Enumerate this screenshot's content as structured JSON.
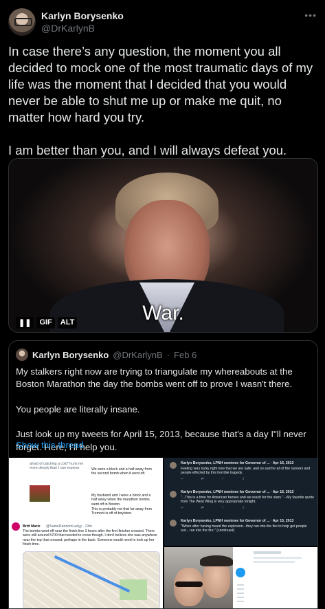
{
  "tweet": {
    "author_name": "Karlyn Borysenko",
    "author_handle": "@DrKarlynB",
    "more_icon": "more-icon",
    "text": "In case there’s any question, the moment you all decided to mock one of the most traumatic days of my life was the moment that I decided that you would never be able to shut me up or make me quit, no matter how hard you try.\n\nI am better than you, and I will always defeat you."
  },
  "gif": {
    "caption": "War.",
    "badges": {
      "pause": "❚❚",
      "gif": "GIF",
      "alt": "ALT"
    }
  },
  "quote": {
    "author_name": "Karlyn Borysenko",
    "author_handle": "@DrKarlynB",
    "separator": "·",
    "date": "Feb 6",
    "text": "My stalkers right now are trying to triangulate my whereabouts at the Boston Marathon the day the bombs went off to prove I wasn't there.\n\nYou people are literally insane.\n\nJust look up my tweets for April 15, 2013, because that's a day I\"ll never forget. Here, I'll help you.",
    "show_thread": "Show this thread"
  },
  "collage": {
    "shot_a": {
      "snippets": [
        "afraid of catching a cold\" hurts me more deeply than I can express",
        "We were a block and a half away from the second bomb when it went off.",
        "My husband and I were a block and a half away when the marathon bombs went off in Boston.",
        "This is probably not that far away from Tremont is off of boylston."
      ],
      "reply_author": "Britt Marie",
      "reply_handle": "@SameRandomLadyy · 23m",
      "reply_text": "The bombs went off near the finish line 3 hours after the first finisher crossed. There were still around 5700 that needed to cross though. I don't believe she was anywhere near the top that crossed, perhaps in the back. Someone would need to look up her finish time."
    },
    "shot_b": {
      "rows": [
        {
          "author": "Karlyn Borysenko, LPNH nominee for Governor of ... · Apr 15, 2013",
          "text": "Feeling very lucky right now that we are safe, and so sad for all of the runners and people effected by this horrible tragedy."
        },
        {
          "author": "Karlyn Borysenko, LPNH nominee for Governor of ... · Apr 15, 2013",
          "text": "\"...This is a time for American heroes and we reach for the stars.\" --My favorite quote from The West Wing is very appropriate tonight."
        },
        {
          "author": "Karlyn Borysenko, LPNH nominee for Governor of ... · Apr 15, 2013",
          "text": "\"When after having heard the explosion...they ran into the fire to help get people out... ran into the fire.\" (continued)"
        }
      ],
      "actions": "↩ ⇄ ♡ ⇪"
    }
  }
}
